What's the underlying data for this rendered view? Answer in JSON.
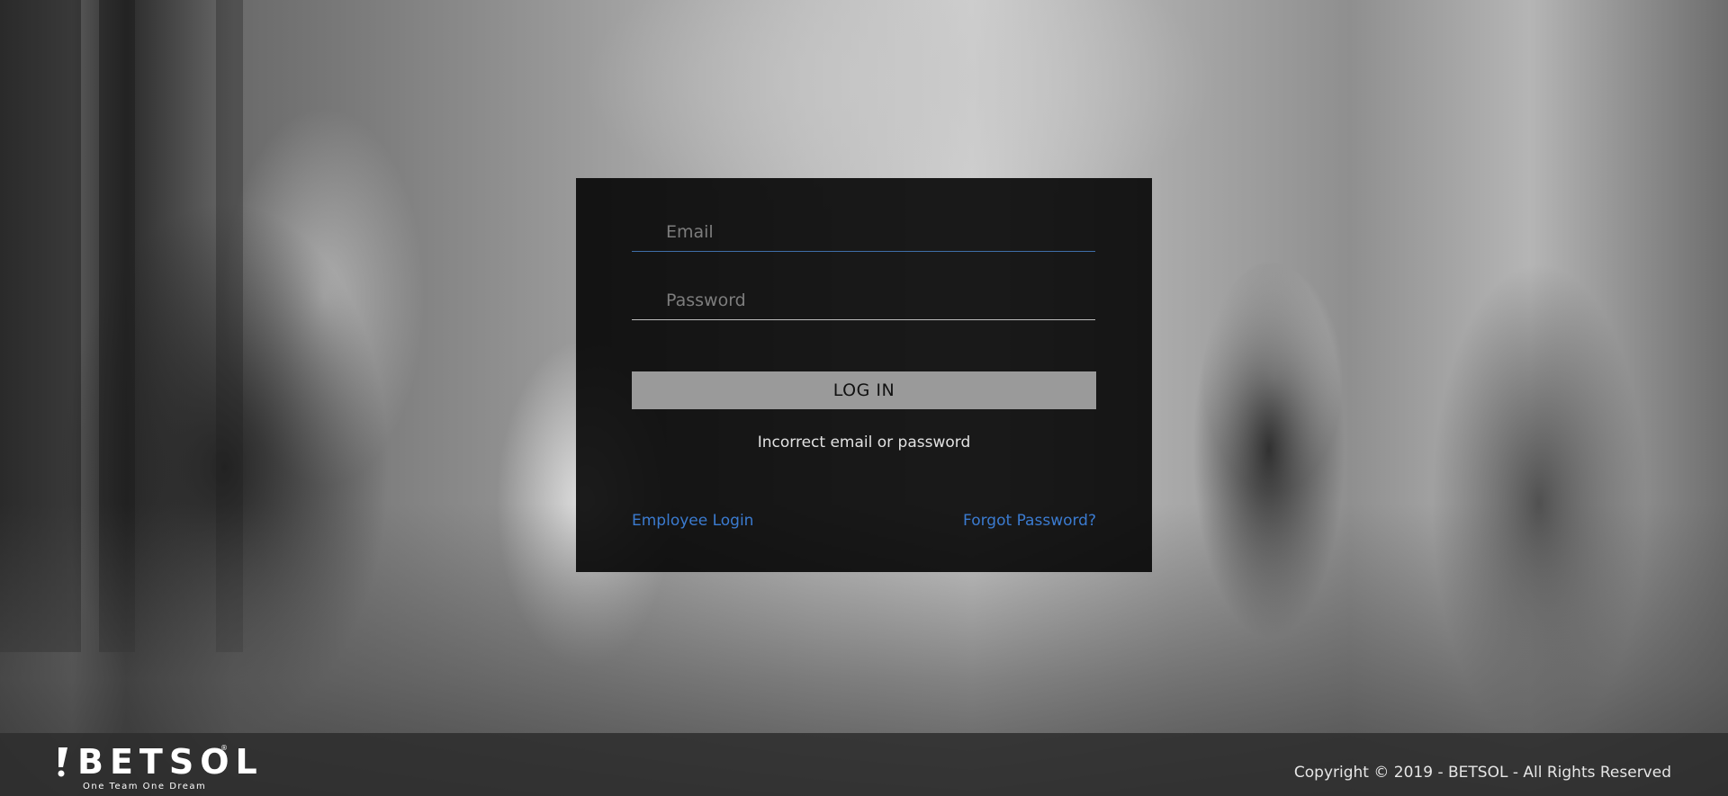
{
  "login_form": {
    "email_placeholder": "Email",
    "email_value": "",
    "password_placeholder": "Password",
    "password_value": "",
    "login_button_label": "LOG IN",
    "error_message": "Incorrect email or password",
    "employee_login_link": "Employee Login",
    "forgot_password_link": "Forgot Password?"
  },
  "footer": {
    "logo_text": "BETSOL",
    "logo_registered": "®",
    "logo_tagline": "One Team One Dream",
    "copyright": "Copyright © 2019 - BETSOL - All Rights Reserved"
  },
  "colors": {
    "link": "#3b7bd0",
    "email_underline": "#3f6ea8",
    "button_background": "#9a9a9a",
    "panel_background": "#000000"
  },
  "icons": {
    "logo_mark": "betsol-logo-mark"
  }
}
